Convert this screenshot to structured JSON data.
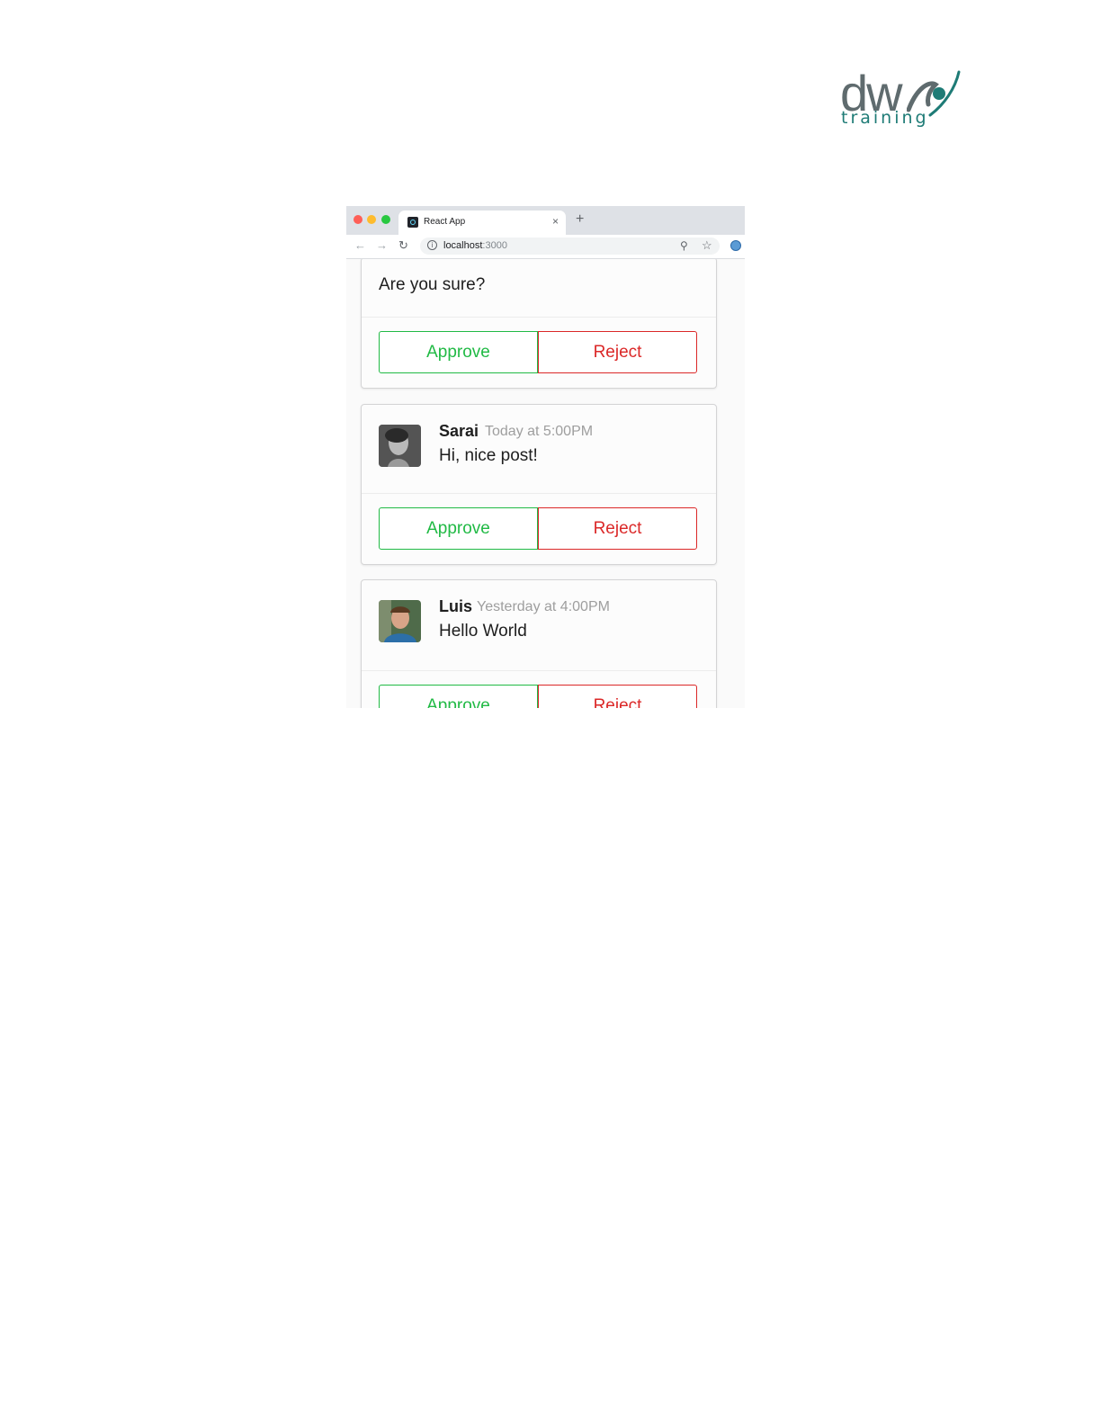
{
  "logo": {
    "wordmark": "dw",
    "subtitle": "training"
  },
  "browser": {
    "tab_title": "React App",
    "tab_close": "×",
    "new_tab": "+",
    "url_host": "localhost",
    "url_port": ":3000"
  },
  "confirm_card": {
    "question": "Are you sure?",
    "approve_label": "Approve",
    "reject_label": "Reject"
  },
  "comments": [
    {
      "author": "Sarai",
      "meta": "Today at 5:00PM",
      "text": "Hi, nice post!",
      "approve_label": "Approve",
      "reject_label": "Reject"
    },
    {
      "author": "Luis",
      "meta": "Yesterday at 4:00PM",
      "text": "Hello World",
      "approve_label": "Approve",
      "reject_label": "Reject"
    }
  ],
  "colors": {
    "approve": "#21ba45",
    "reject": "#db2828",
    "brand_teal": "#1e7b76"
  }
}
